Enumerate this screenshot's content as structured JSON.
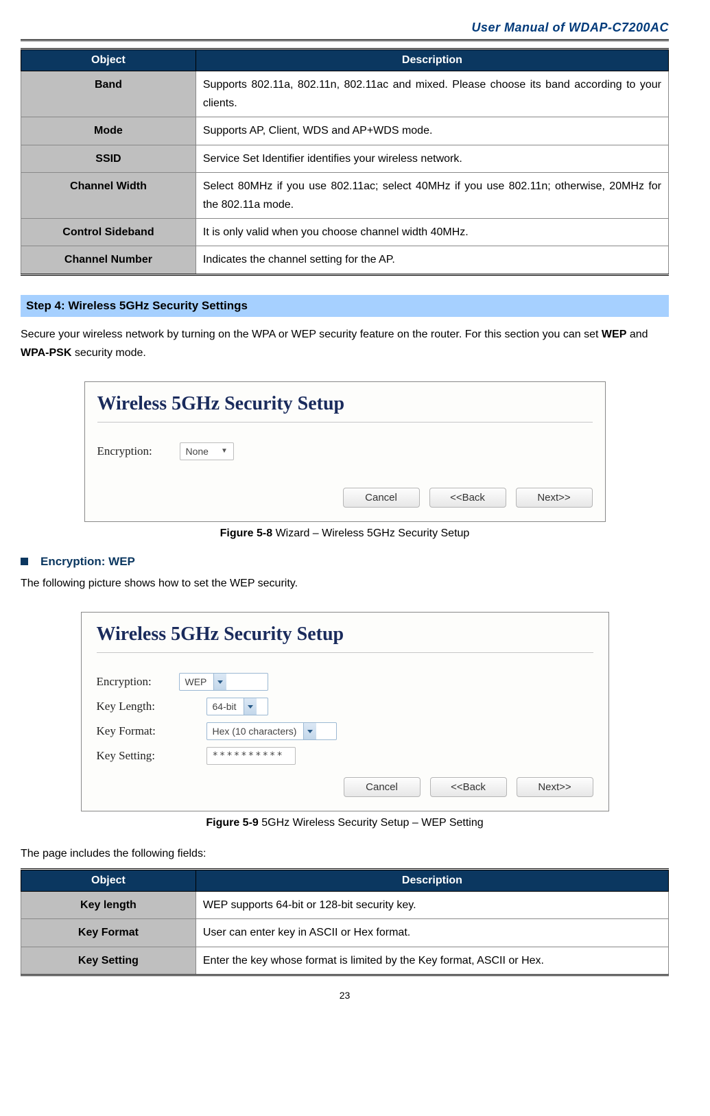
{
  "header": {
    "title": "User Manual of WDAP-C7200AC"
  },
  "table1": {
    "head": {
      "object": "Object",
      "description": "Description"
    },
    "rows": [
      {
        "obj": "Band",
        "desc": "Supports 802.11a, 802.11n, 802.11ac and mixed. Please choose its band according to your clients."
      },
      {
        "obj": "Mode",
        "desc": "Supports AP, Client, WDS and AP+WDS mode."
      },
      {
        "obj": "SSID",
        "desc": "Service Set Identifier identifies your wireless network."
      },
      {
        "obj": "Channel Width",
        "desc": "Select 80MHz if you use 802.11ac; select 40MHz if you use 802.11n; otherwise, 20MHz for the 802.11a mode."
      },
      {
        "obj": "Control Sideband",
        "desc": "It is only valid when you choose channel width 40MHz."
      },
      {
        "obj": "Channel Number",
        "desc": "Indicates the channel setting for the AP."
      }
    ]
  },
  "step4": {
    "heading": "Step 4: Wireless 5GHz Security Settings",
    "intro1": "Secure your wireless network by turning on the WPA or WEP security feature on the router. For this section you can set ",
    "intro_b1": "WEP",
    "intro_mid": " and ",
    "intro_b2": "WPA-PSK",
    "intro_end": " security mode."
  },
  "shot1": {
    "title": "Wireless 5GHz Security Setup",
    "encryption_label": "Encryption:",
    "encryption_value": "None",
    "btn_cancel": "Cancel",
    "btn_back": "<<Back",
    "btn_next": "Next>>"
  },
  "caption1": {
    "bold": "Figure 5-8",
    "rest": " Wizard – Wireless 5GHz Security Setup"
  },
  "bullet1": {
    "text": "Encryption: WEP"
  },
  "wep_intro": "The following picture shows how to set the WEP security.",
  "shot2": {
    "title": "Wireless 5GHz Security Setup",
    "rows": {
      "encryption": {
        "label": "Encryption:",
        "value": "WEP"
      },
      "keylength": {
        "label": "Key Length:",
        "value": "64-bit"
      },
      "keyformat": {
        "label": "Key Format:",
        "value": "Hex (10 characters)"
      },
      "keysetting": {
        "label": "Key Setting:",
        "value": "**********"
      }
    },
    "btn_cancel": "Cancel",
    "btn_back": "<<Back",
    "btn_next": "Next>>"
  },
  "caption2": {
    "bold": "Figure 5-9",
    "rest": " 5GHz Wireless Security Setup – WEP Setting"
  },
  "fields_intro": "The page includes the following fields:",
  "table2": {
    "head": {
      "object": "Object",
      "description": "Description"
    },
    "rows": [
      {
        "obj": "Key length",
        "desc": "WEP supports 64-bit or 128-bit security key."
      },
      {
        "obj": "Key Format",
        "desc": "User can enter key in ASCII or Hex format."
      },
      {
        "obj": "Key Setting",
        "desc": "Enter the key whose format is limited by the Key format, ASCII or Hex."
      }
    ]
  },
  "pagenum": "23"
}
